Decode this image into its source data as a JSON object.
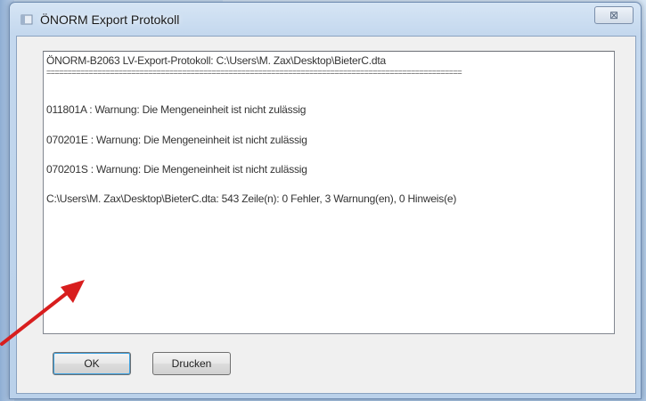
{
  "window": {
    "title": "ÖNORM Export Protokoll",
    "close_glyph": "⊠"
  },
  "log": {
    "lines": [
      "ÖNORM-B2063 LV-Export-Protokoll: C:\\Users\\M. Zax\\Desktop\\BieterC.dta",
      "011801A : Warnung: Die Mengeneinheit ist nicht zulässig",
      "070201E : Warnung: Die Mengeneinheit ist nicht zulässig",
      "070201S : Warnung: Die Mengeneinheit ist nicht zulässig",
      "C:\\Users\\M. Zax\\Desktop\\BieterC.dta: 543 Zeile(n): 0 Fehler, 3 Warnung(en), 0 Hinweis(e)"
    ],
    "separator": "=================================================================================================="
  },
  "buttons": {
    "ok_label": "OK",
    "print_label": "Drucken"
  },
  "colors": {
    "annotation_arrow": "#d81e1e",
    "dialog_bg": "#f0f0f0"
  }
}
